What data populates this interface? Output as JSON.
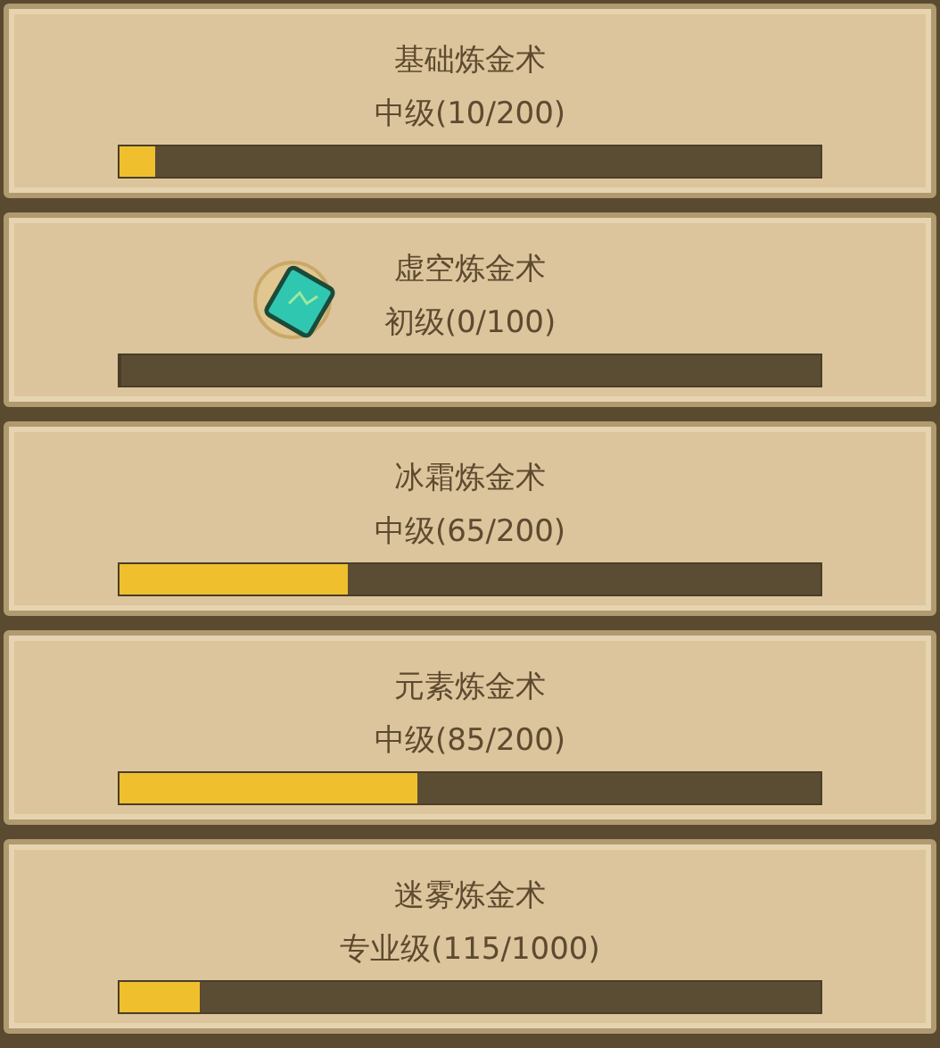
{
  "skills": [
    {
      "name": "基础炼金术",
      "progress": "中级(10/200)",
      "level": 0.05,
      "has_icon": false
    },
    {
      "name": "虚空炼金术",
      "progress": "初级(0/100)",
      "level": 0,
      "has_icon": true
    },
    {
      "name": "冰霜炼金术",
      "progress": "中级(65/200)",
      "level": 0.325,
      "has_icon": false
    },
    {
      "name": "元素炼金术",
      "progress": "中级(85/200)",
      "level": 0.425,
      "has_icon": false
    },
    {
      "name": "迷雾炼金术",
      "progress": "专业级(115/1000)",
      "level": 0.115,
      "has_icon": false
    }
  ]
}
